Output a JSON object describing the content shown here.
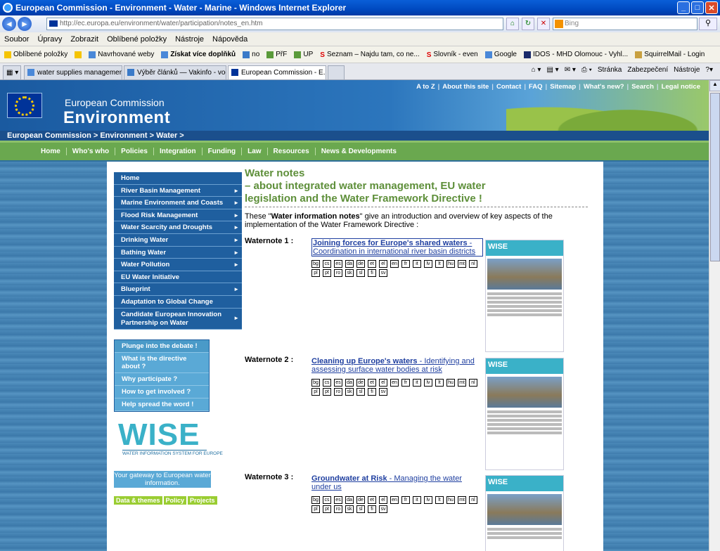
{
  "window": {
    "title": "European Commission - Environment - Water - Marine - Windows Internet Explorer"
  },
  "address": {
    "url": "http://ec.europa.eu/environment/water/participation/notes_en.htm",
    "search_placeholder": "Bing"
  },
  "menu": [
    "Soubor",
    "Úpravy",
    "Zobrazit",
    "Oblíbené položky",
    "Nástroje",
    "Nápověda"
  ],
  "favorites": [
    "Oblíbené položky",
    "Navrhované weby",
    "Získat více doplňků",
    "no",
    "PřF",
    "UP",
    "Seznam – Najdu tam, co ne...",
    "Slovník - even",
    "Google",
    "IDOS - MHD Olomouc - Vyhl...",
    "SquirrelMail - Login"
  ],
  "tabs": [
    "water supplies management ...",
    "Výběr článků — Vakinfo - vod...",
    "European Commission - E..."
  ],
  "tab_tools": [
    "Stránka",
    "Zabezpečení",
    "Nástroje"
  ],
  "site": {
    "toplinks": [
      "A to Z",
      "About this site",
      "Contact",
      "FAQ",
      "Sitemap",
      "What's new?",
      "Search",
      "Legal notice"
    ],
    "org": "European Commission",
    "section": "Environment",
    "breadcrumb": "European Commission  > Environment  > Water  >",
    "nav": [
      "Home",
      "Who's who",
      "Policies",
      "Integration",
      "Funding",
      "Law",
      "Resources",
      "News & Developments"
    ]
  },
  "leftmenu": [
    "Home",
    "River Basin Management",
    "Marine Environment and Coasts",
    "Flood Risk Management",
    "Water Scarcity and Droughts",
    "Drinking Water",
    "Bathing Water",
    "Water Pollution",
    "EU Water Initiative",
    "Blueprint",
    "Adaptation to Global Change",
    "Candidate European Innovation Partnership on Water"
  ],
  "leftmenu2": [
    "Plunge into the debate !",
    "What is the directive about ?",
    "Why participate ?",
    "How to get involved ?",
    "Help spread the word !"
  ],
  "wise": {
    "logo": "WISE",
    "sub": "WATER INFORMATION SYSTEM FOR EUROPE",
    "gateway": "Your gateway to European water information.",
    "links": [
      "Data & themes",
      "Policy",
      "Projects"
    ]
  },
  "main": {
    "title_line1": "Water notes",
    "title_line2": "– about integrated water management, EU water legislation and the Water Framework Directive !",
    "intro_pre": "These \"",
    "intro_bold": "Water information notes",
    "intro_post": "\" give an introduction and overview of key aspects of the implementation of the Water Framework Directive :",
    "notes": [
      {
        "label": "Waternote 1 :",
        "link_bold": "Joining forces for Europe's shared waters",
        "link_rest": " - Coordination in international river basin districts"
      },
      {
        "label": "Waternote 2 :",
        "link_bold": "Cleaning up Europe's waters",
        "link_rest": " - Identifying and assessing surface water bodies at risk"
      },
      {
        "label": "Waternote 3 :",
        "link_bold": "Groundwater at Risk",
        "link_rest": " - Managing the water under us"
      }
    ],
    "languages": [
      "bg",
      "cs",
      "es",
      "da",
      "de",
      "et",
      "el",
      "en",
      "fr",
      "it",
      "lv",
      "lt",
      "hu",
      "mt",
      "nl",
      "pl",
      "pt",
      "ro",
      "sk",
      "sl",
      "fi",
      "sv"
    ],
    "thumb_label": "WISE"
  }
}
